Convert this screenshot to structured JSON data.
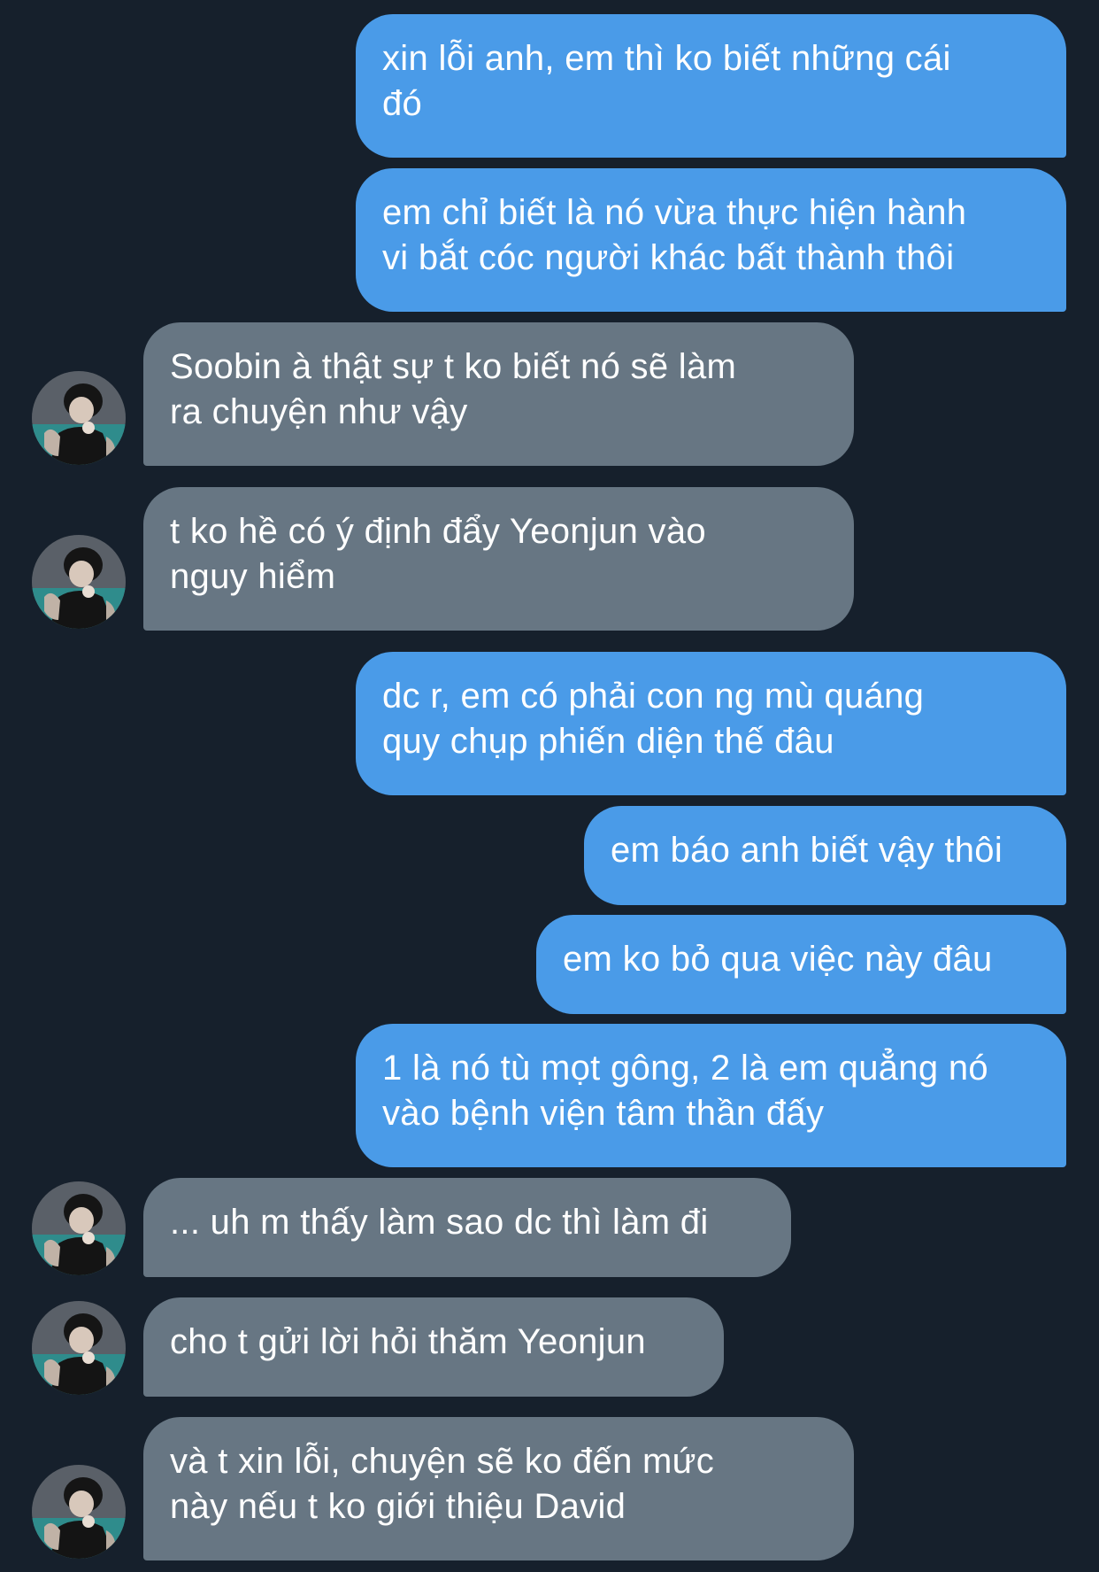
{
  "conversation": {
    "messages": [
      {
        "side": "out",
        "text": "xin lỗi anh, em thì ko biết những cái\nđó"
      },
      {
        "side": "out",
        "text": "em chỉ biết là nó vừa thực hiện hành\nvi bắt cóc người khác bất thành thôi"
      },
      {
        "side": "in",
        "text": "Soobin à thật sự t ko biết nó sẽ làm\nra chuyện như vậy"
      },
      {
        "side": "in",
        "text": "t ko hề có ý định đẩy Yeonjun vào\nnguy hiểm"
      },
      {
        "side": "out",
        "text": "dc r, em có phải con ng mù quáng\nquy chụp phiến diện thế đâu"
      },
      {
        "side": "out",
        "text": "em báo anh biết vậy thôi"
      },
      {
        "side": "out",
        "text": "em ko bỏ qua việc này đâu"
      },
      {
        "side": "out",
        "text": "1 là nó tù mọt gông, 2 là em quẳng nó\nvào bệnh viện tâm thần đấy"
      },
      {
        "side": "in",
        "text": "... uh m thấy làm sao dc thì làm đi"
      },
      {
        "side": "in",
        "text": "cho t gửi lời hỏi thăm Yeonjun"
      },
      {
        "side": "in",
        "text": "và t xin lỗi, chuyện sẽ ko đến mức\nnày nếu t ko giới thiệu David"
      }
    ]
  },
  "colors": {
    "background": "#16202c",
    "outgoing_bubble": "#4a9be8",
    "incoming_bubble": "#677683",
    "text": "#ffffff"
  },
  "icons": {
    "avatar": "contact-avatar-photo"
  }
}
